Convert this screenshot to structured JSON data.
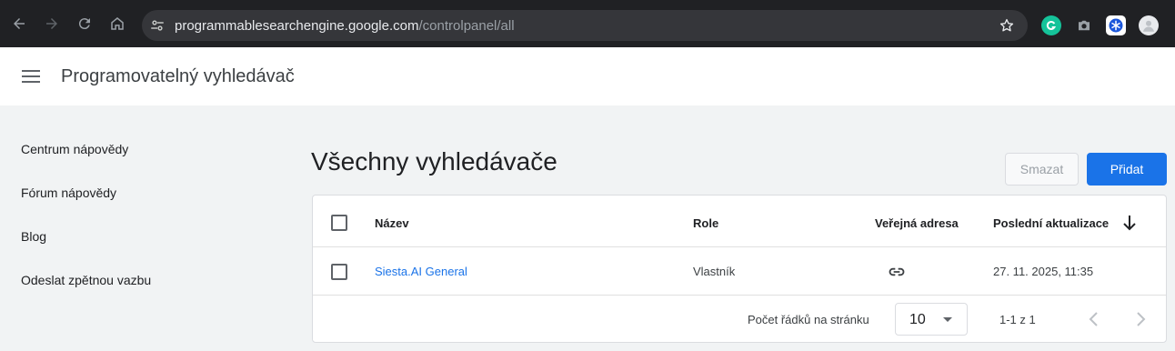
{
  "browser": {
    "url_host": "programmablesearchengine.google.com",
    "url_path": "/controlpanel/all"
  },
  "app": {
    "title": "Programovatelný vyhledávač"
  },
  "sidebar": {
    "items": [
      {
        "label": "Centrum nápovědy"
      },
      {
        "label": "Fórum nápovědy"
      },
      {
        "label": "Blog"
      },
      {
        "label": "Odeslat zpětnou vazbu"
      }
    ]
  },
  "main": {
    "title": "Všechny vyhledávače",
    "delete_label": "Smazat",
    "add_label": "Přidat",
    "table": {
      "headers": {
        "name": "Název",
        "role": "Role",
        "public_url": "Veřejná adresa",
        "last_updated": "Poslední aktualizace"
      },
      "rows": [
        {
          "name": "Siesta.AI General",
          "role": "Vlastník",
          "last_updated": "27. 11. 2025, 11:35"
        }
      ],
      "footer": {
        "rows_per_page_label": "Počet řádků na stránku",
        "rows_per_page_value": "10",
        "range": "1-1 z 1"
      }
    }
  },
  "colors": {
    "accent": "#1a73e8",
    "chrome_bg": "#202124"
  }
}
